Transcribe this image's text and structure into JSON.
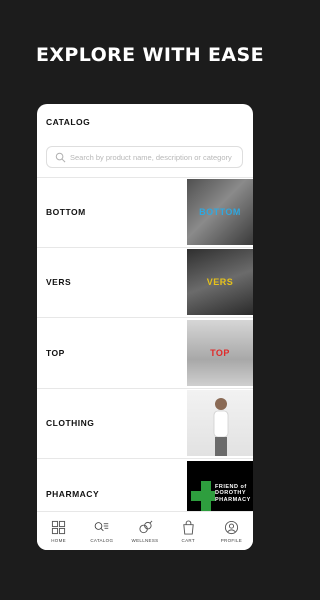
{
  "headline": "EXPLORE WITH EASE",
  "screen": {
    "title": "CATALOG",
    "search_placeholder": "Search by product name, description or category",
    "categories": [
      {
        "label": "BOTTOM",
        "overlay": "BOTTOM",
        "overlay_color": "#2fa8e0"
      },
      {
        "label": "VERS",
        "overlay": "VERS",
        "overlay_color": "#e6c21a"
      },
      {
        "label": "TOP",
        "overlay": "TOP",
        "overlay_color": "#e02a2a"
      },
      {
        "label": "CLOTHING",
        "overlay": "",
        "overlay_color": ""
      },
      {
        "label": "PHARMACY",
        "overlay": "FRIEND of DOROTHY PHARMACY",
        "overlay_color": "#ffffff"
      }
    ],
    "tabs": [
      {
        "label": "HOME",
        "icon": "grid-icon"
      },
      {
        "label": "CATALOG",
        "icon": "catalog-search-icon"
      },
      {
        "label": "WELLNESS",
        "icon": "wellness-icon"
      },
      {
        "label": "CART",
        "icon": "cart-bag-icon"
      },
      {
        "label": "PROFILE",
        "icon": "profile-icon"
      }
    ]
  },
  "colors": {
    "background": "#1c1c1c",
    "pharmacy_green": "#2e9e3e"
  }
}
